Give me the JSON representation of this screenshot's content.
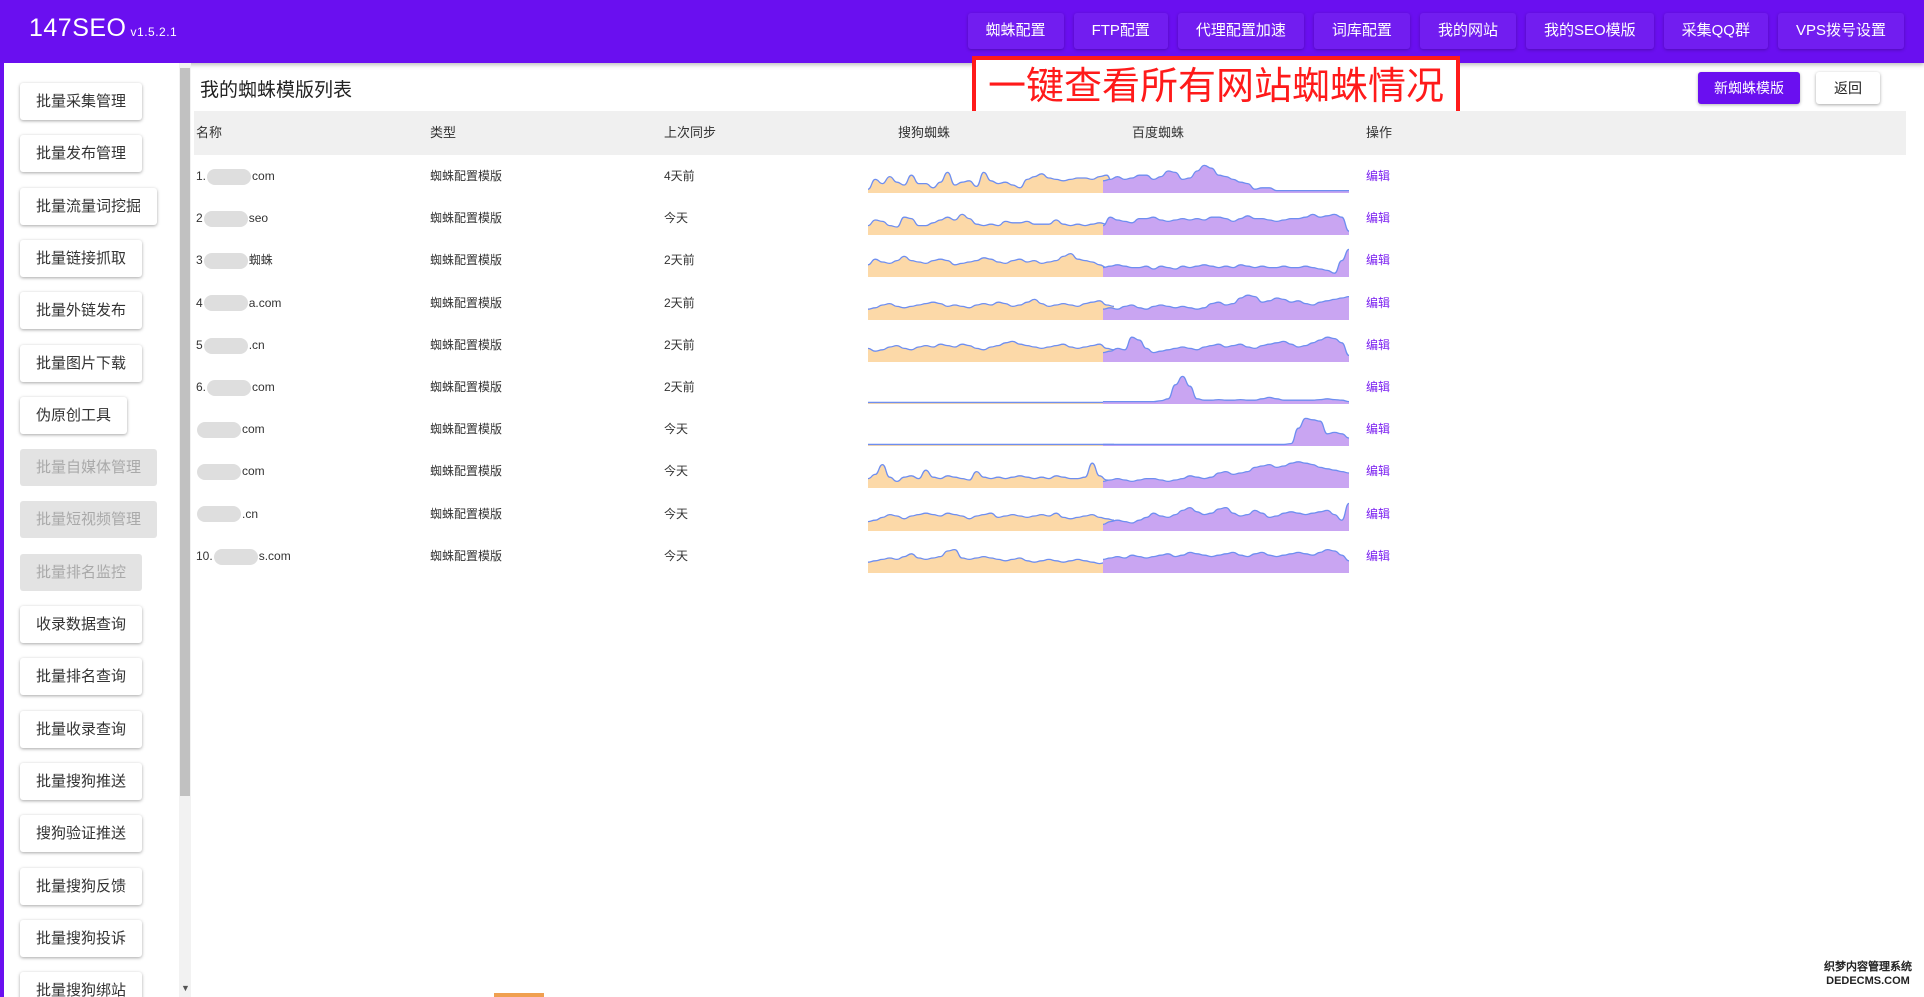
{
  "app": {
    "title": "147SEO",
    "version": "v1.5.2.1"
  },
  "nav": [
    "蜘蛛配置",
    "FTP配置",
    "代理配置加速",
    "词库配置",
    "我的网站",
    "我的SEO模版",
    "采集QQ群",
    "VPS拨号设置"
  ],
  "sidebar": [
    {
      "label": "批量采集管理",
      "disabled": false
    },
    {
      "label": "批量发布管理",
      "disabled": false
    },
    {
      "label": "批量流量词挖掘",
      "disabled": false
    },
    {
      "label": "批量链接抓取",
      "disabled": false
    },
    {
      "label": "批量外链发布",
      "disabled": false
    },
    {
      "label": "批量图片下载",
      "disabled": false
    },
    {
      "label": "伪原创工具",
      "disabled": false
    },
    {
      "label": "批量自媒体管理",
      "disabled": true
    },
    {
      "label": "批量短视频管理",
      "disabled": true
    },
    {
      "label": "批量排名监控",
      "disabled": true
    },
    {
      "label": "收录数据查询",
      "disabled": false
    },
    {
      "label": "批量排名查询",
      "disabled": false
    },
    {
      "label": "批量收录查询",
      "disabled": false
    },
    {
      "label": "批量搜狗推送",
      "disabled": false
    },
    {
      "label": "搜狗验证推送",
      "disabled": false
    },
    {
      "label": "批量搜狗反馈",
      "disabled": false
    },
    {
      "label": "批量搜狗投诉",
      "disabled": false
    },
    {
      "label": "批量搜狗绑站",
      "disabled": false
    }
  ],
  "page": {
    "title": "我的蜘蛛模版列表",
    "banner": "一键查看所有网站蜘蛛情况",
    "new_button": "新蜘蛛模版",
    "back_button": "返回"
  },
  "table": {
    "columns": [
      "名称",
      "类型",
      "上次同步",
      "搜狗蜘蛛",
      "百度蜘蛛",
      "操作"
    ],
    "rows": [
      {
        "prefix": "1.",
        "suffix": "com",
        "type": "蜘蛛配置模版",
        "sync": "4天前",
        "action": "编辑",
        "sogou": [
          0.1,
          0.45,
          0.3,
          0.55,
          0.35,
          0.25,
          0.6,
          0.3,
          0.3,
          0.15,
          0.35,
          0.7,
          0.25,
          0.35,
          0.4,
          0.2,
          0.7,
          0.4,
          0.3,
          0.35,
          0.25,
          0.15,
          0.45,
          0.55,
          0.65,
          0.5,
          0.45,
          0.4,
          0.45,
          0.5,
          0.5,
          0.45,
          0.55,
          0.6,
          0.15
        ],
        "baidu": [
          0.4,
          0.45,
          0.55,
          0.45,
          0.5,
          0.6,
          0.6,
          0.45,
          0.55,
          0.75,
          0.7,
          0.45,
          0.5,
          0.75,
          0.95,
          0.85,
          0.6,
          0.55,
          0.45,
          0.35,
          0.3,
          0.1,
          0.15,
          0.15,
          0.05,
          0.05,
          0.05,
          0.05,
          0.05,
          0.05,
          0.05,
          0.05,
          0.05,
          0.05,
          0.05
        ]
      },
      {
        "prefix": "2",
        "suffix": "seo",
        "type": "蜘蛛配置模版",
        "sync": "今天",
        "action": "编辑",
        "sogou": [
          0.3,
          0.5,
          0.45,
          0.3,
          0.25,
          0.6,
          0.55,
          0.3,
          0.3,
          0.4,
          0.5,
          0.6,
          0.5,
          0.7,
          0.55,
          0.35,
          0.3,
          0.35,
          0.3,
          0.45,
          0.4,
          0.4,
          0.45,
          0.35,
          0.35,
          0.35,
          0.5,
          0.35,
          0.3,
          0.35,
          0.3,
          0.35,
          0.4,
          0.35,
          0.35
        ],
        "baidu": [
          0.3,
          0.6,
          0.5,
          0.45,
          0.4,
          0.55,
          0.55,
          0.6,
          0.5,
          0.45,
          0.5,
          0.55,
          0.5,
          0.55,
          0.5,
          0.6,
          0.6,
          0.55,
          0.45,
          0.55,
          0.65,
          0.55,
          0.55,
          0.5,
          0.45,
          0.5,
          0.55,
          0.55,
          0.6,
          0.7,
          0.6,
          0.65,
          0.7,
          0.6,
          0.1
        ]
      },
      {
        "prefix": "3",
        "suffix": "蜘蛛",
        "type": "蜘蛛配置模版",
        "sync": "2天前",
        "action": "编辑",
        "sogou": [
          0.4,
          0.6,
          0.5,
          0.45,
          0.55,
          0.7,
          0.55,
          0.5,
          0.45,
          0.55,
          0.6,
          0.55,
          0.4,
          0.45,
          0.5,
          0.55,
          0.65,
          0.6,
          0.5,
          0.45,
          0.55,
          0.6,
          0.5,
          0.55,
          0.45,
          0.5,
          0.55,
          0.7,
          0.8,
          0.6,
          0.55,
          0.5,
          0.4,
          0.3,
          0.15
        ],
        "baidu": [
          0.3,
          0.35,
          0.4,
          0.35,
          0.3,
          0.3,
          0.35,
          0.25,
          0.35,
          0.3,
          0.25,
          0.35,
          0.3,
          0.35,
          0.4,
          0.35,
          0.3,
          0.35,
          0.3,
          0.4,
          0.35,
          0.3,
          0.35,
          0.3,
          0.3,
          0.35,
          0.3,
          0.3,
          0.35,
          0.3,
          0.25,
          0.2,
          0.1,
          0.55,
          0.95
        ]
      },
      {
        "prefix": "4",
        "suffix": "a.com",
        "type": "蜘蛛配置模版",
        "sync": "2天前",
        "action": "编辑",
        "sogou": [
          0.35,
          0.4,
          0.5,
          0.55,
          0.45,
          0.4,
          0.45,
          0.5,
          0.55,
          0.6,
          0.55,
          0.45,
          0.5,
          0.45,
          0.4,
          0.5,
          0.55,
          0.5,
          0.6,
          0.55,
          0.45,
          0.5,
          0.6,
          0.7,
          0.55,
          0.45,
          0.5,
          0.55,
          0.5,
          0.45,
          0.55,
          0.6,
          0.65,
          0.5,
          0.45
        ],
        "baidu": [
          0.35,
          0.4,
          0.35,
          0.45,
          0.5,
          0.4,
          0.35,
          0.45,
          0.5,
          0.45,
          0.4,
          0.45,
          0.4,
          0.35,
          0.4,
          0.55,
          0.6,
          0.5,
          0.55,
          0.75,
          0.85,
          0.8,
          0.6,
          0.65,
          0.75,
          0.7,
          0.6,
          0.65,
          0.55,
          0.5,
          0.6,
          0.65,
          0.7,
          0.75,
          0.8
        ]
      },
      {
        "prefix": "5",
        "suffix": ".cn",
        "type": "蜘蛛配置模版",
        "sync": "2天前",
        "action": "编辑",
        "sogou": [
          0.45,
          0.35,
          0.4,
          0.5,
          0.55,
          0.45,
          0.4,
          0.5,
          0.55,
          0.5,
          0.6,
          0.55,
          0.5,
          0.6,
          0.55,
          0.45,
          0.4,
          0.5,
          0.55,
          0.65,
          0.7,
          0.6,
          0.55,
          0.5,
          0.45,
          0.5,
          0.55,
          0.6,
          0.5,
          0.45,
          0.5,
          0.55,
          0.6,
          0.45,
          0.4
        ],
        "baidu": [
          0.3,
          0.35,
          0.45,
          0.4,
          0.85,
          0.75,
          0.45,
          0.3,
          0.35,
          0.4,
          0.45,
          0.5,
          0.45,
          0.4,
          0.5,
          0.55,
          0.6,
          0.5,
          0.55,
          0.6,
          0.5,
          0.45,
          0.55,
          0.6,
          0.65,
          0.7,
          0.6,
          0.5,
          0.55,
          0.65,
          0.75,
          0.85,
          0.8,
          0.65,
          0.2
        ]
      },
      {
        "prefix": "6.",
        "suffix": "com",
        "type": "蜘蛛配置模版",
        "sync": "2天前",
        "action": "编辑",
        "sogou": [
          0.02,
          0.02,
          0.02,
          0.02,
          0.02,
          0.02,
          0.02,
          0.02,
          0.02,
          0.02,
          0.02,
          0.02,
          0.02,
          0.02,
          0.02,
          0.02,
          0.02,
          0.02,
          0.02,
          0.02,
          0.02,
          0.02,
          0.02,
          0.02,
          0.02,
          0.02,
          0.02,
          0.02,
          0.02,
          0.02,
          0.02,
          0.02,
          0.02,
          0.02,
          0.02
        ],
        "baidu": [
          0.05,
          0.05,
          0.05,
          0.05,
          0.05,
          0.05,
          0.05,
          0.05,
          0.08,
          0.15,
          0.65,
          0.95,
          0.6,
          0.15,
          0.1,
          0.1,
          0.12,
          0.1,
          0.1,
          0.12,
          0.1,
          0.1,
          0.15,
          0.2,
          0.15,
          0.1,
          0.1,
          0.1,
          0.1,
          0.1,
          0.12,
          0.15,
          0.12,
          0.1,
          0.05
        ]
      },
      {
        "prefix": "",
        "suffix": "com",
        "type": "蜘蛛配置模版",
        "sync": "今天",
        "action": "编辑",
        "sogou": [
          0.02,
          0.02,
          0.02,
          0.02,
          0.02,
          0.02,
          0.02,
          0.02,
          0.02,
          0.02,
          0.02,
          0.02,
          0.02,
          0.02,
          0.02,
          0.02,
          0.02,
          0.02,
          0.02,
          0.02,
          0.02,
          0.02,
          0.02,
          0.02,
          0.02,
          0.02,
          0.02,
          0.02,
          0.02,
          0.02,
          0.02,
          0.02,
          0.02,
          0.02,
          0.02
        ],
        "baidu": [
          0.02,
          0.02,
          0.02,
          0.02,
          0.02,
          0.02,
          0.02,
          0.02,
          0.02,
          0.02,
          0.02,
          0.02,
          0.02,
          0.02,
          0.02,
          0.02,
          0.02,
          0.02,
          0.02,
          0.02,
          0.02,
          0.02,
          0.02,
          0.02,
          0.02,
          0.02,
          0.05,
          0.6,
          0.95,
          0.9,
          0.85,
          0.4,
          0.45,
          0.4,
          0.25
        ]
      },
      {
        "prefix": "",
        "suffix": "com",
        "type": "蜘蛛配置模版",
        "sync": "今天",
        "action": "编辑",
        "sogou": [
          0.3,
          0.45,
          0.8,
          0.35,
          0.2,
          0.35,
          0.4,
          0.3,
          0.6,
          0.35,
          0.3,
          0.4,
          0.35,
          0.3,
          0.25,
          0.55,
          0.35,
          0.3,
          0.35,
          0.3,
          0.35,
          0.4,
          0.35,
          0.3,
          0.35,
          0.3,
          0.4,
          0.35,
          0.3,
          0.3,
          0.35,
          0.85,
          0.4,
          0.25,
          0.2
        ],
        "baidu": [
          0.2,
          0.25,
          0.3,
          0.25,
          0.2,
          0.25,
          0.3,
          0.3,
          0.25,
          0.2,
          0.25,
          0.3,
          0.4,
          0.35,
          0.3,
          0.35,
          0.5,
          0.55,
          0.45,
          0.5,
          0.55,
          0.7,
          0.75,
          0.8,
          0.7,
          0.75,
          0.85,
          0.9,
          0.85,
          0.8,
          0.7,
          0.65,
          0.6,
          0.55,
          0.5
        ]
      },
      {
        "prefix": "",
        "suffix": ".cn",
        "type": "蜘蛛配置模版",
        "sync": "今天",
        "action": "编辑",
        "sogou": [
          0.3,
          0.35,
          0.45,
          0.55,
          0.5,
          0.4,
          0.5,
          0.55,
          0.6,
          0.55,
          0.5,
          0.6,
          0.55,
          0.5,
          0.4,
          0.5,
          0.55,
          0.6,
          0.45,
          0.5,
          0.55,
          0.5,
          0.45,
          0.5,
          0.55,
          0.5,
          0.6,
          0.45,
          0.4,
          0.45,
          0.5,
          0.55,
          0.45,
          0.4,
          0.35
        ],
        "baidu": [
          0.2,
          0.3,
          0.35,
          0.3,
          0.25,
          0.35,
          0.45,
          0.6,
          0.5,
          0.45,
          0.55,
          0.7,
          0.8,
          0.65,
          0.55,
          0.6,
          0.75,
          0.8,
          0.6,
          0.5,
          0.55,
          0.7,
          0.6,
          0.45,
          0.5,
          0.6,
          0.65,
          0.6,
          0.55,
          0.6,
          0.65,
          0.7,
          0.55,
          0.35,
          0.95
        ]
      },
      {
        "prefix": "10.",
        "suffix": "s.com",
        "type": "蜘蛛配置模版",
        "sync": "今天",
        "action": "编辑",
        "sogou": [
          0.35,
          0.4,
          0.45,
          0.5,
          0.45,
          0.55,
          0.65,
          0.5,
          0.45,
          0.5,
          0.55,
          0.75,
          0.8,
          0.5,
          0.45,
          0.5,
          0.55,
          0.5,
          0.45,
          0.4,
          0.45,
          0.5,
          0.4,
          0.35,
          0.4,
          0.45,
          0.4,
          0.35,
          0.4,
          0.45,
          0.4,
          0.35,
          0.3,
          0.35,
          0.3
        ],
        "baidu": [
          0.45,
          0.5,
          0.55,
          0.5,
          0.6,
          0.55,
          0.5,
          0.55,
          0.6,
          0.65,
          0.55,
          0.6,
          0.7,
          0.65,
          0.6,
          0.55,
          0.6,
          0.65,
          0.7,
          0.6,
          0.55,
          0.65,
          0.7,
          0.6,
          0.55,
          0.6,
          0.65,
          0.7,
          0.65,
          0.6,
          0.7,
          0.8,
          0.75,
          0.6,
          0.4
        ]
      }
    ]
  },
  "watermark": {
    "line1": "织梦内容管理系统",
    "line2": "DEDECMS.COM"
  },
  "colors": {
    "brand": "#6a0ff0",
    "sogou_fill": "#fcd9a8",
    "baidu_fill": "#c9a5f2",
    "line": "#6e8ef0",
    "banner": "#ff1a1a"
  }
}
